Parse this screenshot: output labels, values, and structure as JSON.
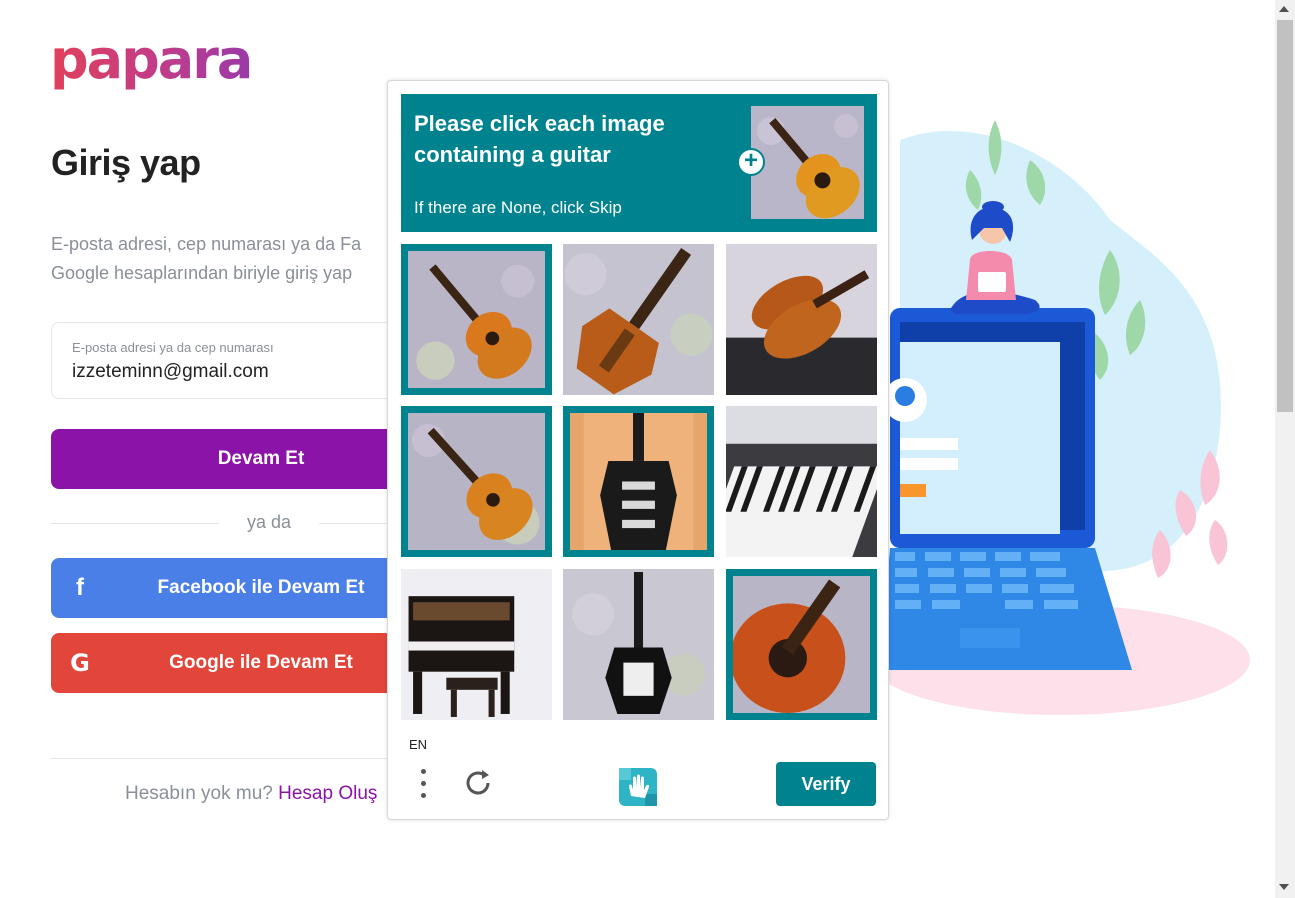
{
  "brand": {
    "logo_text": "papara",
    "primary_color": "#8c13a8",
    "facebook_color": "#4a7fe8",
    "google_color": "#e2463a"
  },
  "login": {
    "title": "Giriş yap",
    "intro_line1": "E-posta adresi, cep numarası ya da Fa",
    "intro_line2": "Google hesaplarından biriyle giriş yap",
    "email_label": "E-posta adresi ya da cep numarası",
    "email_value": "izzeteminn@gmail.com",
    "continue_label": "Devam Et",
    "divider_text": "ya da",
    "facebook_icon": "f",
    "facebook_label": "Facebook ile Devam Et",
    "google_icon": "G",
    "google_label": "Google ile Devam Et",
    "no_account_text": "Hesabın yok mu?",
    "create_account_link": "Hesap Oluş"
  },
  "captcha": {
    "accent_color": "#00838f",
    "title": "Please click each image containing a guitar",
    "subtitle": "If there are None, click Skip",
    "sample_icon": "plus-icon",
    "tiles": [
      {
        "subject": "acoustic-guitar",
        "selected": true
      },
      {
        "subject": "electric-violin",
        "selected": false
      },
      {
        "subject": "violin",
        "selected": false
      },
      {
        "subject": "acoustic-guitar",
        "selected": true
      },
      {
        "subject": "electric-guitar",
        "selected": true
      },
      {
        "subject": "piano-keys",
        "selected": false
      },
      {
        "subject": "upright-piano",
        "selected": false
      },
      {
        "subject": "electric-guitar",
        "selected": false
      },
      {
        "subject": "acoustic-guitar-closeup",
        "selected": true
      }
    ],
    "language": "EN",
    "verify_label": "Verify"
  }
}
